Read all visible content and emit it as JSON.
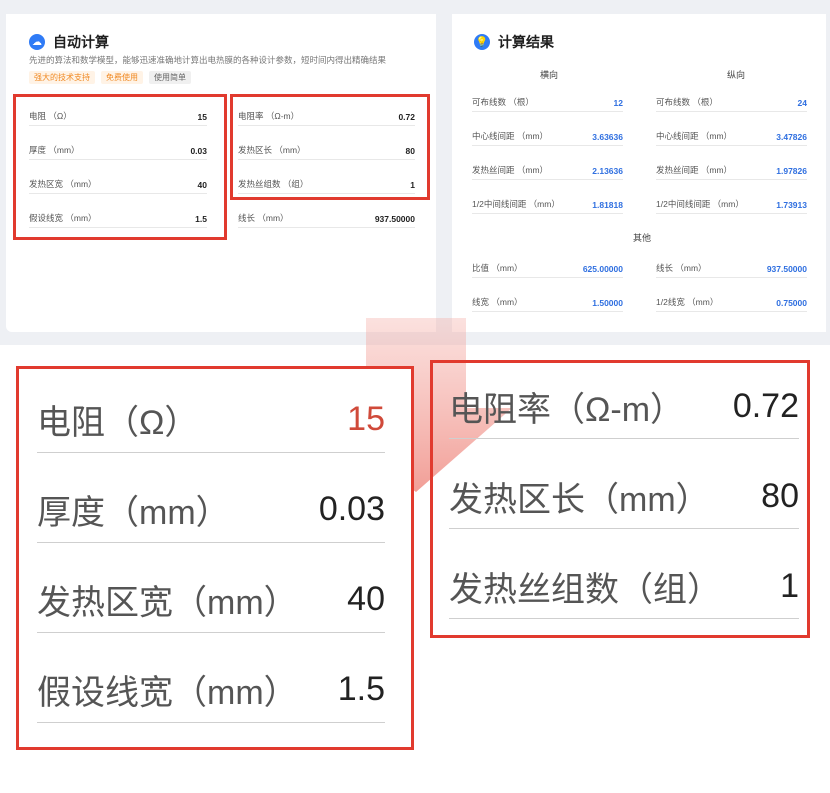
{
  "calc": {
    "title": "自动计算",
    "description": "先进的算法和数学模型，能够迅速准确地计算出电热膜的各种设计参数，短时间内得出精确结果",
    "tags": [
      "强大的技术支持",
      "免费使用",
      "使用简单"
    ],
    "inputs_left": [
      {
        "label": "电阻 （Ω）",
        "value": "15"
      },
      {
        "label": "厚度 （mm）",
        "value": "0.03"
      },
      {
        "label": "发热区宽 （mm）",
        "value": "40"
      },
      {
        "label": "假设线宽 （mm）",
        "value": "1.5"
      }
    ],
    "inputs_right": [
      {
        "label": "电阻率 （Ω-m）",
        "value": "0.72"
      },
      {
        "label": "发热区长 （mm）",
        "value": "80"
      },
      {
        "label": "发热丝组数 （组）",
        "value": "1"
      }
    ],
    "line_length": {
      "label": "线长 （mm）",
      "value": "937.50000"
    }
  },
  "results": {
    "title": "计算结果",
    "col_horizontal": "横向",
    "col_vertical": "纵向",
    "horizontal": [
      {
        "label": "可布线数 （根）",
        "value": "12"
      },
      {
        "label": "中心线间距 （mm）",
        "value": "3.63636"
      },
      {
        "label": "发热丝间距 （mm）",
        "value": "2.13636"
      },
      {
        "label": "1/2中间线间距 （mm）",
        "value": "1.81818"
      }
    ],
    "vertical": [
      {
        "label": "可布线数 （根）",
        "value": "24"
      },
      {
        "label": "中心线间距 （mm）",
        "value": "3.47826"
      },
      {
        "label": "发热丝间距 （mm）",
        "value": "1.97826"
      },
      {
        "label": "1/2中间线间距 （mm）",
        "value": "1.73913"
      }
    ],
    "other_title": "其他",
    "other_left": [
      {
        "label": "比值 （mm）",
        "value": "625.00000"
      },
      {
        "label": "线宽 （mm）",
        "value": "1.50000"
      }
    ],
    "other_right": [
      {
        "label": "线长 （mm）",
        "value": "937.50000"
      },
      {
        "label": "1/2线宽 （mm）",
        "value": "0.75000"
      }
    ]
  },
  "zoom_left": [
    {
      "label": "电阻（Ω）",
      "value": "15"
    },
    {
      "label": "厚度（mm）",
      "value": "0.03"
    },
    {
      "label": "发热区宽（mm）",
      "value": "40"
    },
    {
      "label": "假设线宽（mm）",
      "value": "1.5"
    }
  ],
  "zoom_right": [
    {
      "label": "电阻率（Ω-m）",
      "value": "0.72"
    },
    {
      "label": "发热区长（mm）",
      "value": "80"
    },
    {
      "label": "发热丝组数（组）",
      "value": "1"
    }
  ],
  "colors": {
    "accent": "#2f7bf6",
    "highlight": "#e13a2e"
  }
}
